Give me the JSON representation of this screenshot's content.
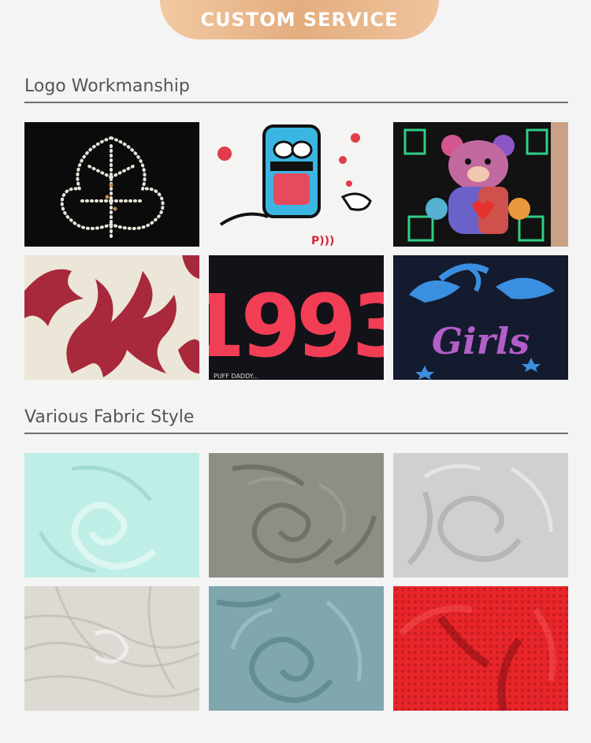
{
  "banner": {
    "title": "CUSTOM SERVICE"
  },
  "logo_section": {
    "title": "Logo Workmanship",
    "items": [
      {
        "type": "rhinestone-leaf"
      },
      {
        "type": "cartoon-print"
      },
      {
        "type": "teddy-bear-print"
      },
      {
        "type": "flame-print"
      },
      {
        "type": "number-print",
        "text": "1993"
      },
      {
        "type": "dolphin-glitter-print",
        "text": "Girls"
      }
    ]
  },
  "fabric_section": {
    "title": "Various Fabric Style",
    "items": [
      {
        "color": "#bfeee6"
      },
      {
        "color": "#8e8e86"
      },
      {
        "color": "#cfd0d0"
      },
      {
        "color": "#dcdad3"
      },
      {
        "color": "#7fa7ad"
      },
      {
        "color": "#e8262a"
      }
    ]
  }
}
